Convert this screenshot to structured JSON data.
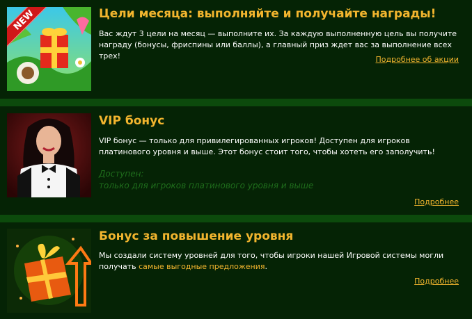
{
  "promos": [
    {
      "badge": "NEW",
      "title": "Цели месяца: выполняйте и получайте награды!",
      "description": "Вас ждут 3 цели на месяц — выполните их. За каждую выполненную цель вы получите награду (бонусы, фриспины или баллы), а главный приз ждет вас за выполнение всех трех!",
      "link": "Подробнее об акции"
    },
    {
      "title": "VIP бонус",
      "description": "VIP бонус — только для привилегированных игроков! Доступен для игроков платинового уровня и выше. Этот бонус стоит того, чтобы хотеть его заполучить!",
      "available_label": "Доступен:",
      "available_value": "только для игроков платинового уровня и выше",
      "link": "Подробнее"
    },
    {
      "title": "Бонус за повышение уровня",
      "description_prefix": "Мы создали систему уровней для того, чтобы игроки нашей Игровой системы могли получать ",
      "description_highlight": "самые выгодные предложения",
      "description_suffix": ".",
      "link": "Подробнее"
    }
  ],
  "colors": {
    "background": "#052305",
    "separator": "#0c4a0c",
    "accent": "#f2b52e",
    "muted_green": "#1f6e1c"
  }
}
